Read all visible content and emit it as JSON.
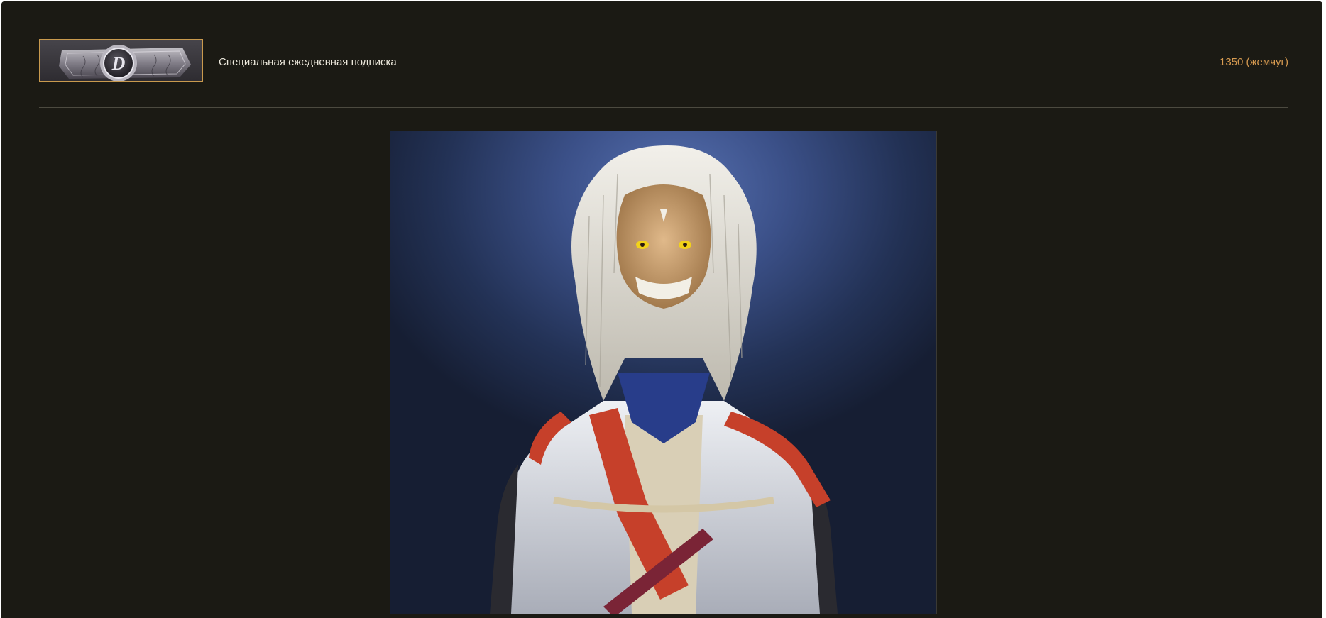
{
  "item": {
    "title": "Специальная ежедневная подписка",
    "price": "1350 (жемчуг)",
    "thumbnail_icon": "silver-ring-D-emblem-icon",
    "thumbnail_letter": "D",
    "artwork": "costume-character-artwork"
  },
  "colors": {
    "background": "#1b1a14",
    "thumbnail_border": "#c99a4e",
    "price_text": "#d69a50",
    "title_text": "#ece8dc"
  }
}
